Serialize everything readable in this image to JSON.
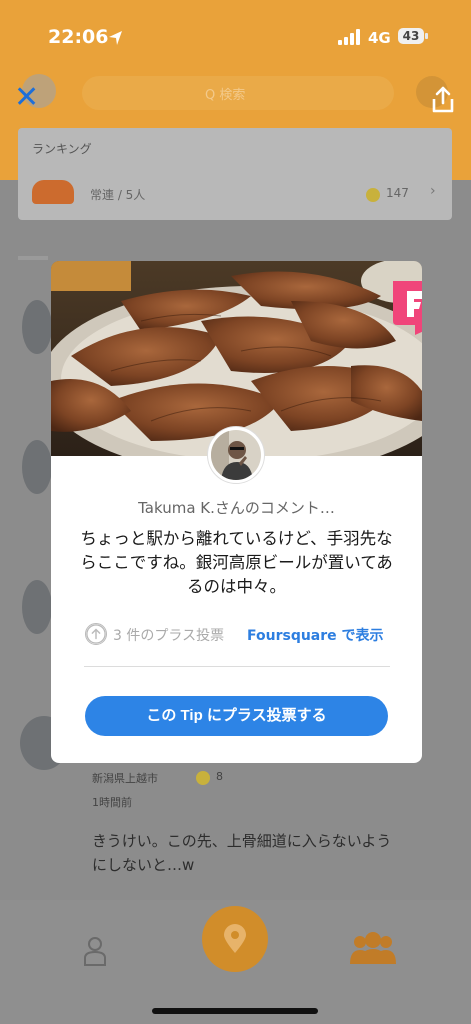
{
  "status_bar": {
    "time": "22:06",
    "network": "4G",
    "battery": "43"
  },
  "header": {
    "search_placeholder": "Q 検索"
  },
  "ranking": {
    "title": "ランキング",
    "item": "常連 / 5人",
    "count": "147"
  },
  "background_feed": {
    "text_line1": "きうけい。この先、上骨細道に入らないよう",
    "text_line2": "にしないと…w",
    "meta1": "新潟県上越市",
    "meta2": "1時間前",
    "coin_count": "8"
  },
  "tip_card": {
    "author_line": "Takuma K.さんのコメント…",
    "tip_text": "ちょっと駅から離れているけど、手羽先ならここですね。銀河高原ビールが置いてあるのは中々。",
    "upvote_count": "3 件のプラス投票",
    "view_link": "Foursquare で表示",
    "upvote_button": "この Tip にプラス投票する"
  },
  "colors": {
    "brand_orange": "#e9a23a",
    "link_blue": "#2d7ee0",
    "button_blue": "#2d84e6",
    "foursquare_pink": "#f0457a"
  },
  "icons": [
    "close-icon",
    "share-icon",
    "foursquare-icon",
    "upvote-arrow-icon",
    "profile-icon",
    "pin-icon",
    "people-icon"
  ]
}
